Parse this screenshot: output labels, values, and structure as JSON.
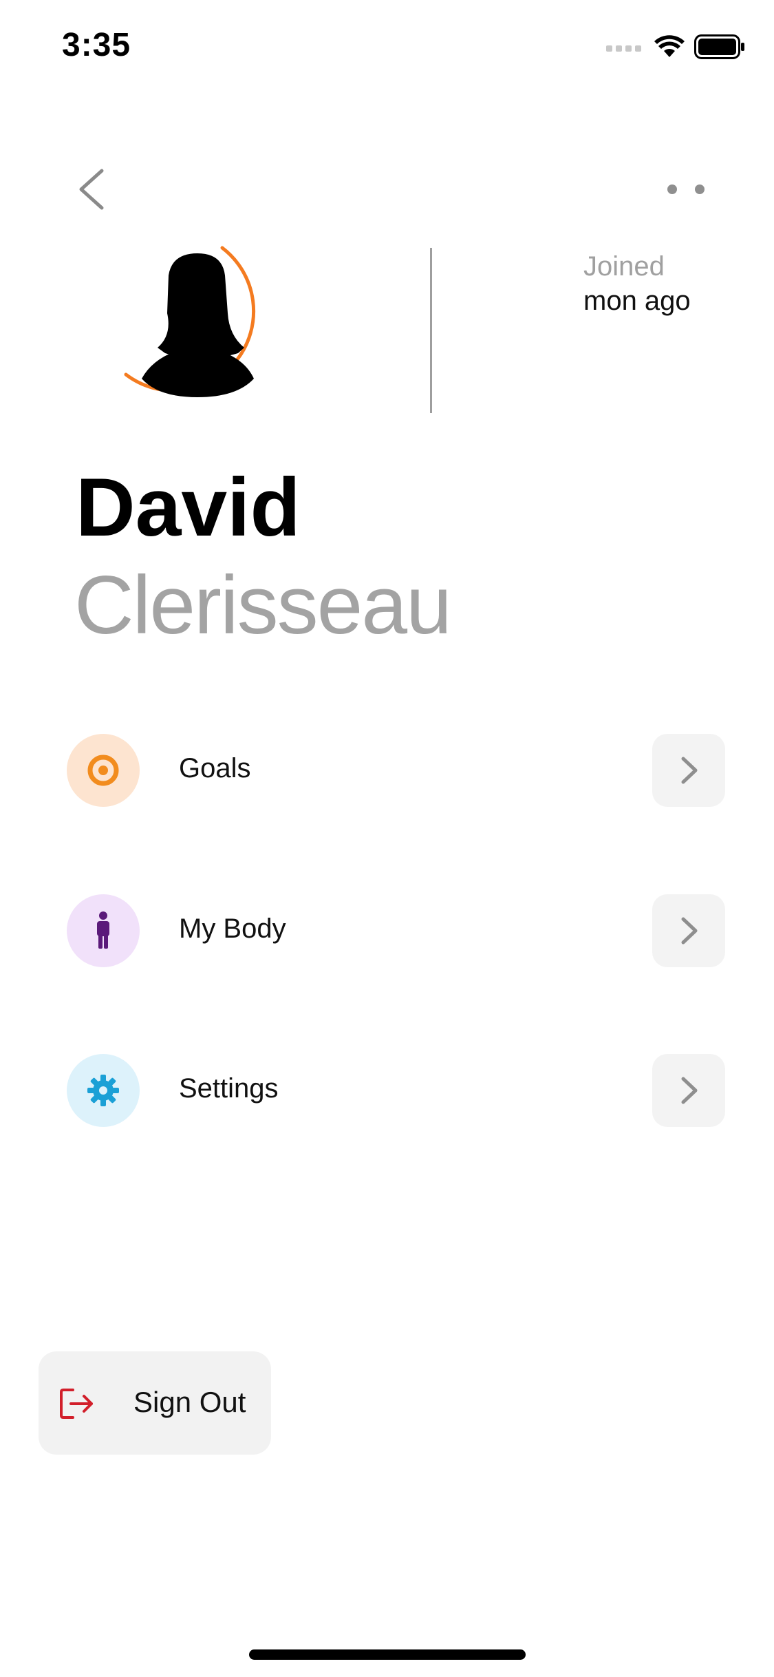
{
  "status_bar": {
    "time": "3:35",
    "icons": [
      "signal-icon",
      "wifi-icon",
      "battery-icon"
    ]
  },
  "header": {
    "back_icon": "chevron-left-icon",
    "more_icon": "more-dots-icon"
  },
  "profile": {
    "avatar_icon": "female-silhouette-icon",
    "ring_color": "#F47B20",
    "joined_label": "Joined",
    "joined_value": "mon ago",
    "first_name": "David",
    "last_name": "Clerisseau"
  },
  "menu": {
    "items": [
      {
        "label": "Goals",
        "icon": "target-icon",
        "icon_color": "#F28C1E",
        "bg_color": "#FDE4D0"
      },
      {
        "label": "My Body",
        "icon": "person-icon",
        "icon_color": "#5B1A7A",
        "bg_color": "#F1E1FA"
      },
      {
        "label": "Settings",
        "icon": "gear-icon",
        "icon_color": "#1AA0D6",
        "bg_color": "#DDF2FB"
      }
    ],
    "chevron_icon": "chevron-right-icon"
  },
  "sign_out": {
    "label": "Sign Out",
    "icon": "sign-out-icon",
    "icon_color": "#D21F2B"
  }
}
